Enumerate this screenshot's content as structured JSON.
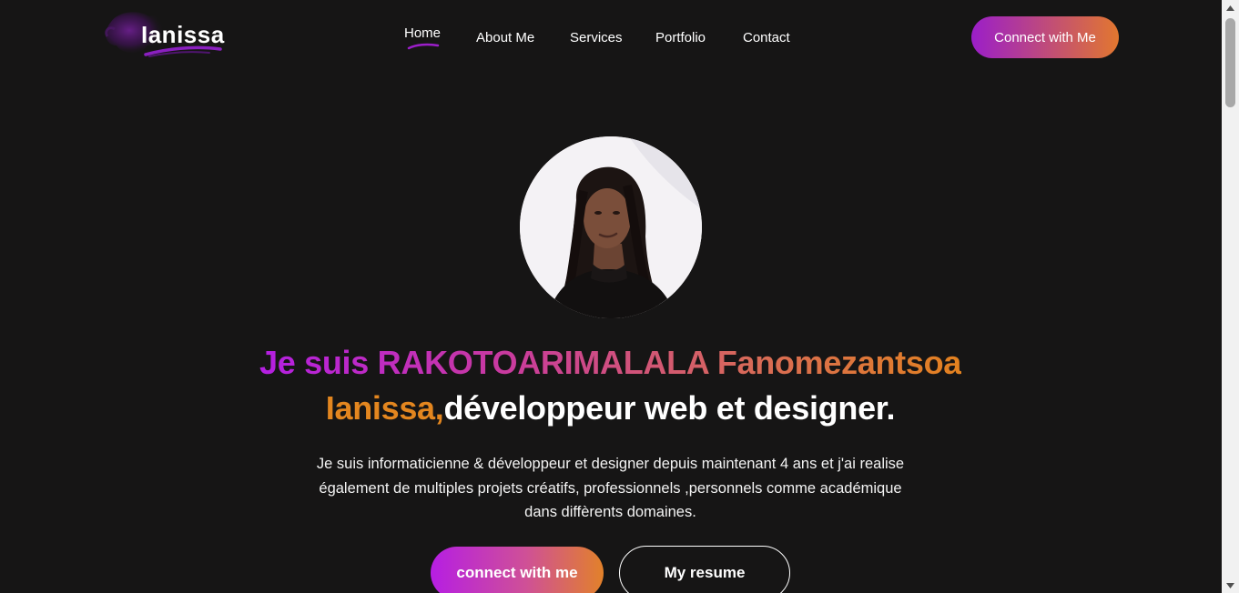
{
  "header": {
    "logo_text": "Ianissa",
    "nav": [
      {
        "label": "Home",
        "active": true
      },
      {
        "label": "About Me",
        "active": false
      },
      {
        "label": "Services",
        "active": false
      },
      {
        "label": "Portfolio",
        "active": false
      },
      {
        "label": "Contact",
        "active": false
      }
    ],
    "cta_label": "Connect with Me"
  },
  "hero": {
    "headline_part1": "Je suis RAKOTOARIMALALA Fanomezantsoa",
    "headline_part2": "Ianissa,",
    "headline_part3": "développeur web et designer.",
    "description": "Je suis informaticienne & développeur et designer depuis maintenant 4 ans et j'ai realise également de multiples projets créatifs, professionnels ,personnels comme académique dans diffèrents domaines.",
    "primary_button": "connect with me",
    "secondary_button": "My resume"
  },
  "colors": {
    "background": "#161515",
    "accent_purple": "#b41fe2",
    "accent_orange": "#e3861f",
    "text": "#ffffff"
  }
}
